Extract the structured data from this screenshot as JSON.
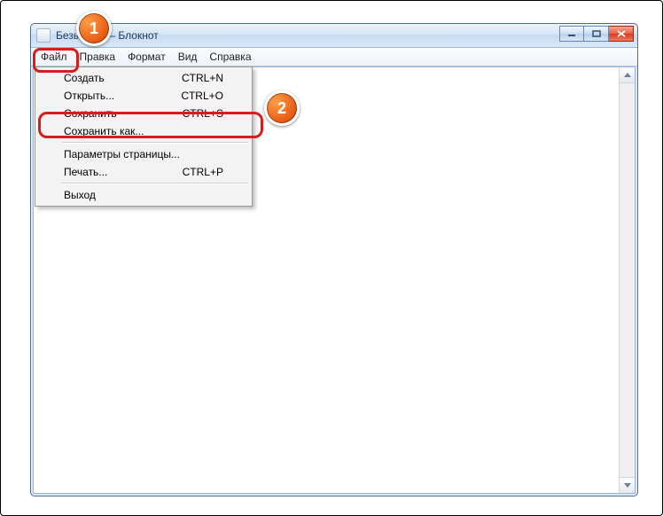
{
  "window": {
    "title_prefix": "Безы",
    "title_suffix": "— Блокнот"
  },
  "menubar": {
    "items": [
      "Файл",
      "Правка",
      "Формат",
      "Вид",
      "Справка"
    ]
  },
  "dropdown": {
    "items": [
      {
        "label": "Создать",
        "shortcut": "CTRL+N"
      },
      {
        "label": "Открыть...",
        "shortcut": "CTRL+O"
      },
      {
        "label": "Сохранить",
        "shortcut": "CTRL+S"
      },
      {
        "label": "Сохранить как...",
        "shortcut": ""
      },
      {
        "label": "Параметры страницы...",
        "shortcut": ""
      },
      {
        "label": "Печать...",
        "shortcut": "CTRL+P"
      },
      {
        "label": "Выход",
        "shortcut": ""
      }
    ]
  },
  "callouts": {
    "one": "1",
    "two": "2"
  }
}
